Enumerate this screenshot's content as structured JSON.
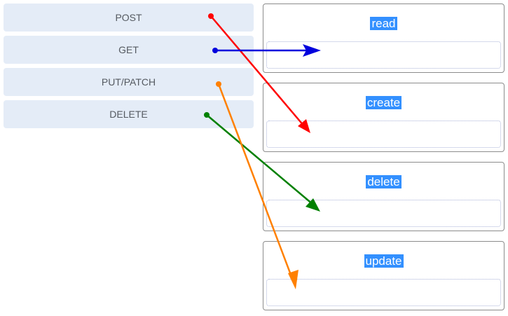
{
  "terms": [
    {
      "id": "post",
      "label": "POST"
    },
    {
      "id": "get",
      "label": "GET"
    },
    {
      "id": "put_patch",
      "label": "PUT/PATCH"
    },
    {
      "id": "delete",
      "label": "DELETE"
    }
  ],
  "targets": [
    {
      "id": "read",
      "label": "read"
    },
    {
      "id": "create",
      "label": "create"
    },
    {
      "id": "delete",
      "label": "delete"
    },
    {
      "id": "update",
      "label": "update"
    }
  ],
  "connections": [
    {
      "from": "POST",
      "to": "create",
      "color": "#ff0000"
    },
    {
      "from": "GET",
      "to": "read",
      "color": "#0000dd"
    },
    {
      "from": "PUT/PATCH",
      "to": "update",
      "color": "#ff8000"
    },
    {
      "from": "DELETE",
      "to": "delete",
      "color": "#008000"
    }
  ]
}
